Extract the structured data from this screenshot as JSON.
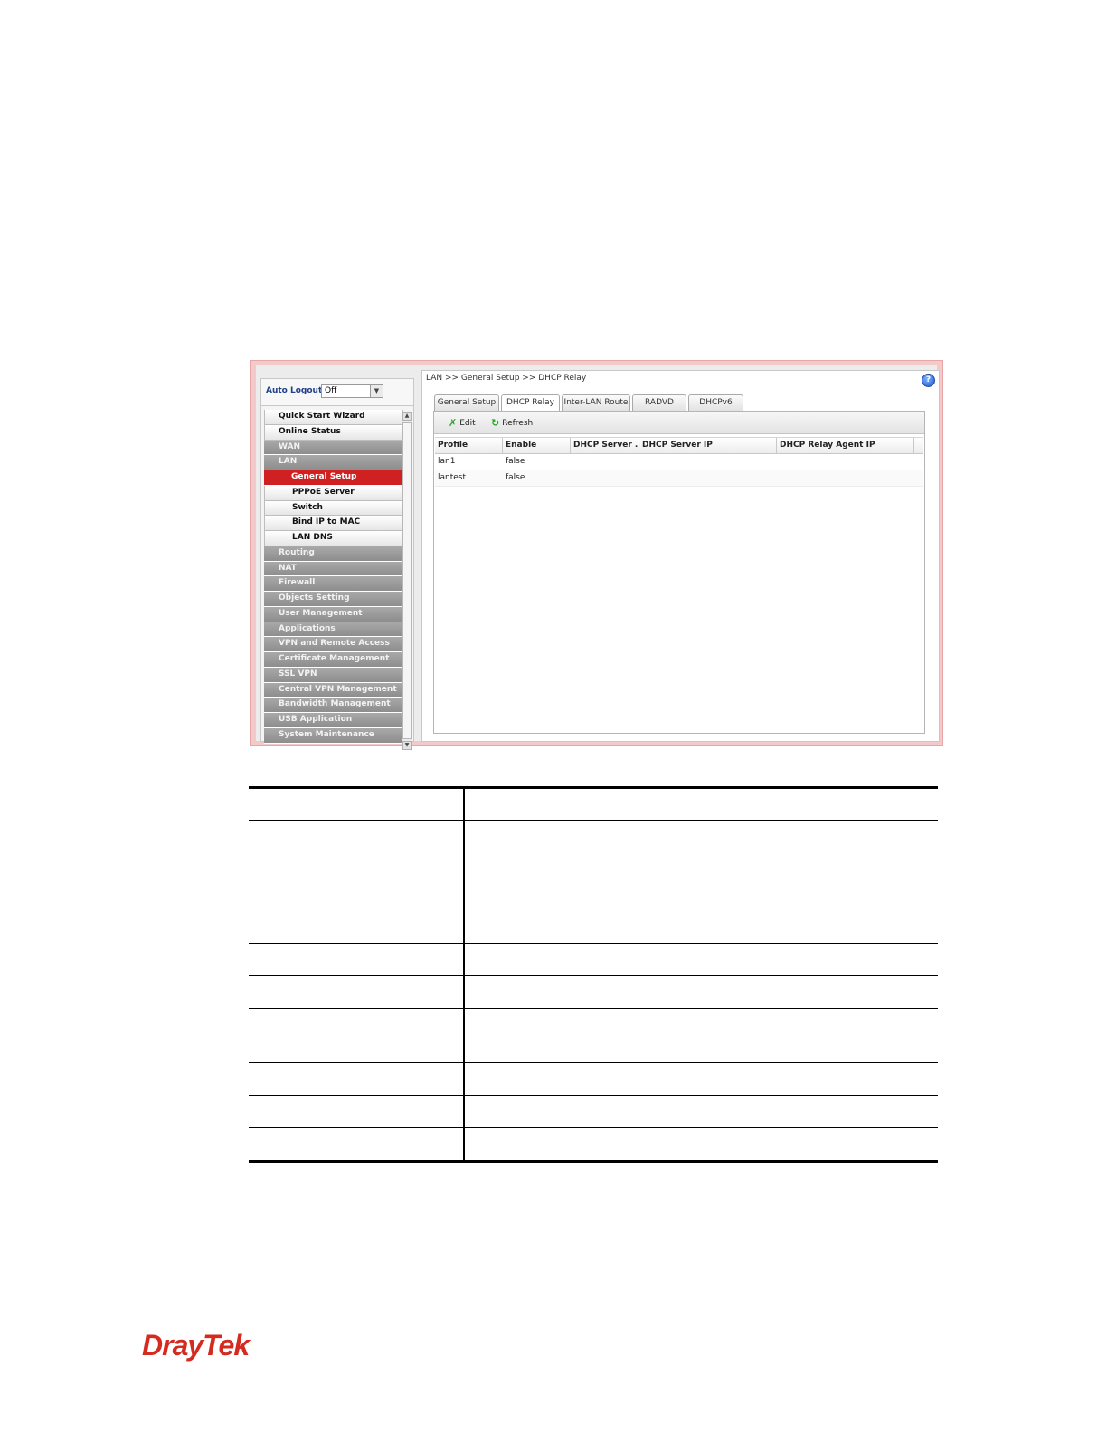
{
  "screenshot": {
    "breadcrumb": "LAN >> General Setup >> DHCP Relay",
    "help_icon": "?",
    "auto_logout": {
      "label": "Auto Logout :",
      "value": "Off"
    },
    "menu": [
      {
        "label": "Quick Start Wizard",
        "kind": "top"
      },
      {
        "label": "Online Status",
        "kind": "top"
      },
      {
        "label": "WAN",
        "kind": "group"
      },
      {
        "label": "LAN",
        "kind": "group"
      },
      {
        "label": "General Setup",
        "kind": "active"
      },
      {
        "label": "PPPoE Server",
        "kind": "sub"
      },
      {
        "label": "Switch",
        "kind": "sub"
      },
      {
        "label": "Bind IP to MAC",
        "kind": "sub"
      },
      {
        "label": "LAN DNS",
        "kind": "sub"
      },
      {
        "label": "Routing",
        "kind": "group"
      },
      {
        "label": "NAT",
        "kind": "group"
      },
      {
        "label": "Firewall",
        "kind": "group"
      },
      {
        "label": "Objects Setting",
        "kind": "group"
      },
      {
        "label": "User Management",
        "kind": "group"
      },
      {
        "label": "Applications",
        "kind": "group"
      },
      {
        "label": "VPN and Remote Access",
        "kind": "group"
      },
      {
        "label": "Certificate Management",
        "kind": "group"
      },
      {
        "label": "SSL VPN",
        "kind": "group"
      },
      {
        "label": "Central VPN Management",
        "kind": "group"
      },
      {
        "label": "Bandwidth Management",
        "kind": "group"
      },
      {
        "label": "USB Application",
        "kind": "group"
      },
      {
        "label": "System Maintenance",
        "kind": "group"
      }
    ],
    "tabs": [
      "General Setup",
      "DHCP Relay",
      "Inter-LAN Route",
      "RADVD",
      "DHCPv6"
    ],
    "active_tab": "DHCP Relay",
    "toolbar": {
      "edit_label": "Edit",
      "refresh_label": "Refresh"
    },
    "grid": {
      "columns": [
        "Profile",
        "Enable",
        "DHCP Server ...",
        "DHCP Server IP",
        "DHCP Relay Agent IP"
      ],
      "rows": [
        [
          "lan1",
          "false",
          "",
          "",
          ""
        ],
        [
          "lantest",
          "false",
          "",
          "",
          ""
        ]
      ]
    }
  },
  "footer": {
    "logo_text": "DrayTek",
    "brand_color": "#d42a20"
  }
}
